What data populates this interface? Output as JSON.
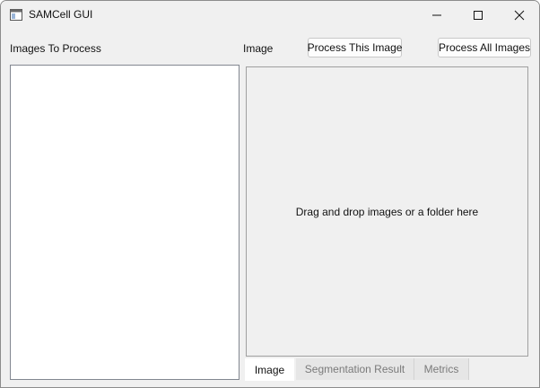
{
  "window": {
    "title": "SAMCell GUI",
    "icon": "app-window-icon",
    "controls": {
      "minimize": "minimize-icon",
      "maximize": "maximize-icon",
      "close": "close-icon"
    }
  },
  "left_panel": {
    "label": "Images To Process",
    "items": []
  },
  "right_panel": {
    "label": "Image",
    "process_this_label": "Process This Image",
    "process_all_label": "Process All Images",
    "drop_hint": "Drag and drop images or a folder here"
  },
  "tabs": [
    {
      "label": "Image",
      "active": true
    },
    {
      "label": "Segmentation Result",
      "active": false
    },
    {
      "label": "Metrics",
      "active": false
    }
  ],
  "colors": {
    "window_bg": "#f0f0f0",
    "panel_bg": "#ffffff",
    "inactive_tab_text": "#7a7a7a"
  }
}
